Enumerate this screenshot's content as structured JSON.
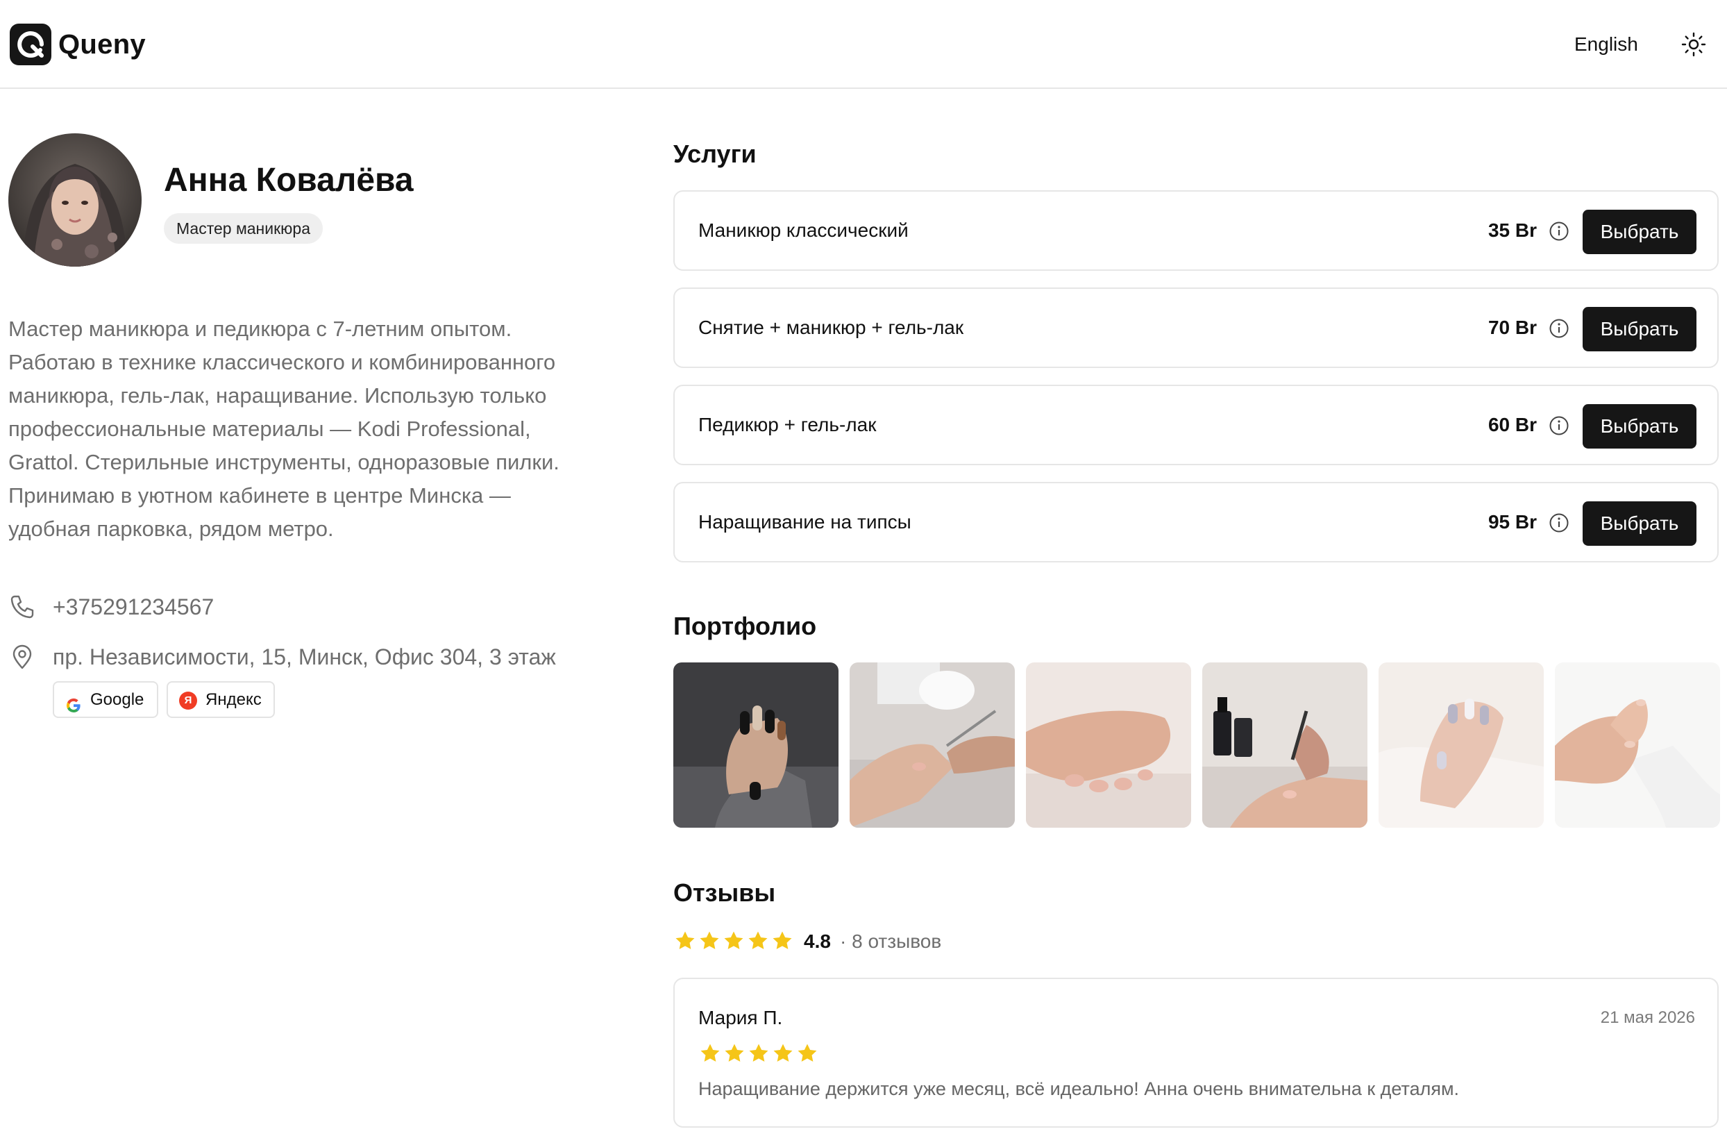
{
  "header": {
    "brand": "Queny",
    "language": "English"
  },
  "profile": {
    "name": "Анна Ковалёва",
    "role": "Мастер маникюра",
    "bio_lines": [
      "Мастер маникюра и педикюра с 7-летним опытом.",
      "Работаю в технике классического и комбинированного",
      "маникюра, гель-лак, наращивание. Использую только",
      "профессиональные материалы — Kodi Professional,",
      "Grattol. Стерильные инструменты, одноразовые пилки.",
      "Принимаю в уютном кабинете в центре Минска —",
      "удобная парковка, рядом метро."
    ],
    "phone": "+375291234567",
    "address": "пр. Независимости, 15, Минск, Офис 304, 3 этаж",
    "map_google": "Google",
    "map_yandex": "Яндекс",
    "yandex_letter": "Я"
  },
  "services": {
    "title": "Услуги",
    "button_label": "Выбрать",
    "items": [
      {
        "name": "Маникюр классический",
        "price": "35 Br"
      },
      {
        "name": "Снятие + маникюр + гель-лак",
        "price": "70 Br"
      },
      {
        "name": "Педикюр + гель-лак",
        "price": "60 Br"
      },
      {
        "name": "Наращивание на типсы",
        "price": "95 Br"
      }
    ]
  },
  "portfolio": {
    "title": "Портфолио",
    "count": 6
  },
  "reviews": {
    "title": "Отзывы",
    "rating": "4.8",
    "stars": 5,
    "count_label": "· 8 отзывов",
    "items": [
      {
        "author": "Мария П.",
        "date": "21 мая 2026",
        "stars": 5,
        "text": "Наращивание держится уже месяц, всё идеально! Анна очень внимательна к деталям."
      }
    ]
  },
  "colors": {
    "accent": "#161616",
    "star": "#f5c518",
    "muted_text": "#6e6e6e",
    "border": "#e6e6e6"
  }
}
